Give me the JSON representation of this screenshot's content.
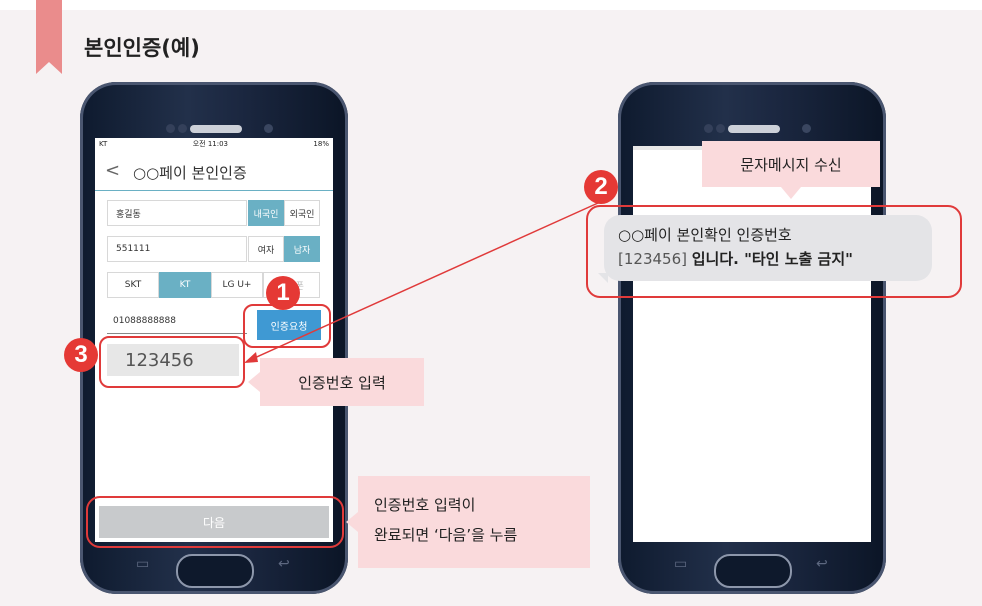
{
  "page": {
    "title": "본인인증(예)"
  },
  "left_phone": {
    "status": {
      "carrier": "KT",
      "time": "오전 11:03",
      "battery": "18%"
    },
    "header": {
      "back": "<",
      "title": "○○페이 본인인증"
    },
    "form": {
      "name_value": "홍길동",
      "nationality": {
        "options": [
          "내국인",
          "외국인"
        ],
        "selected": "내국인"
      },
      "birth_value": "551111",
      "gender": {
        "options": [
          "여자",
          "남자"
        ],
        "selected": "남자"
      },
      "carriers": {
        "options": [
          "SKT",
          "KT",
          "LG U+",
          "알뜰폰"
        ],
        "selected": "KT"
      },
      "phone_value": "01088888888",
      "request_label": "인증요청",
      "code_value": "123456",
      "next_label": "다음"
    }
  },
  "right_phone": {
    "sms": {
      "line1": "○○페이 본인확인 인증번호",
      "line2_code": "[123456]",
      "line2_rest": "입니다. \"타인 노출 금지\""
    }
  },
  "callouts": {
    "code_input": "인증번호 입력",
    "sms_received": "문자메시지 수신",
    "next_line1": "인증번호 입력이",
    "next_line2": "완료되면 ‘다음’을 누름"
  },
  "steps": {
    "one": "1",
    "two": "2",
    "three": "3"
  },
  "colors": {
    "accent_red": "#e03a3a",
    "teal": "#6ab0c4",
    "blue_button": "#3f99d3",
    "callout_pink": "#fadadc"
  }
}
